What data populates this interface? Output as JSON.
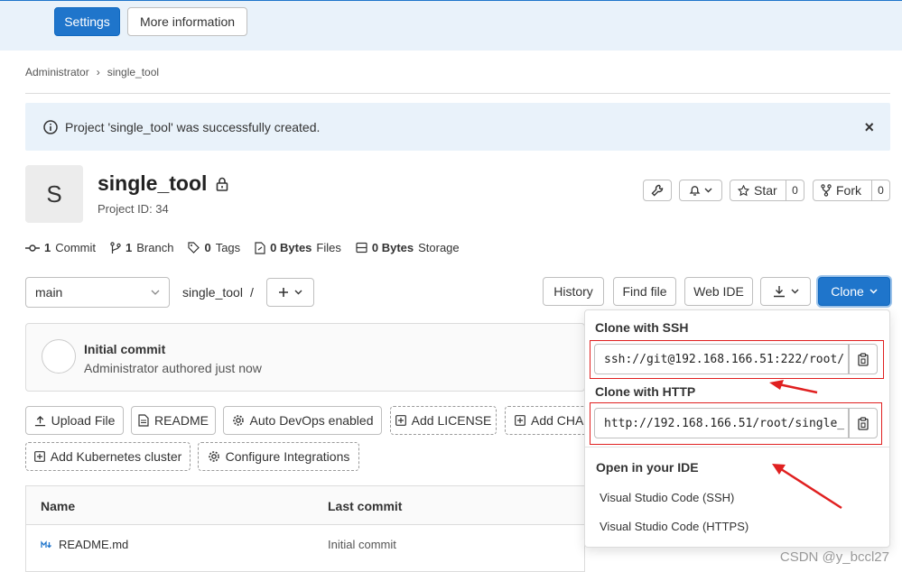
{
  "top": {
    "settings": "Settings",
    "more_info": "More information"
  },
  "breadcrumb": {
    "parent": "Administrator",
    "sep": "›",
    "current": "single_tool"
  },
  "alert": {
    "text": "Project 'single_tool' was successfully created.",
    "close": "×"
  },
  "project": {
    "avatar_letter": "S",
    "name": "single_tool",
    "id_text": "Project ID: 34"
  },
  "actions": {
    "star": "Star",
    "star_count": "0",
    "fork": "Fork",
    "fork_count": "0"
  },
  "stats": {
    "commits_n": "1",
    "commits_label": "Commit",
    "branches_n": "1",
    "branches_label": "Branch",
    "tags_n": "0",
    "tags_label": "Tags",
    "files_n": "0 Bytes",
    "files_label": "Files",
    "storage_n": "0 Bytes",
    "storage_label": "Storage"
  },
  "repo": {
    "branch": "main",
    "path": "single_tool",
    "path_sep": "/",
    "history": "History",
    "find_file": "Find file",
    "web_ide": "Web IDE",
    "clone": "Clone"
  },
  "commit": {
    "title": "Initial commit",
    "author": "Administrator",
    "meta": "authored just now"
  },
  "quick": {
    "upload": "Upload File",
    "readme": "README",
    "autodevops": "Auto DevOps enabled",
    "license": "Add LICENSE",
    "changelog": "Add CHA",
    "k8s": "Add Kubernetes cluster",
    "integrations": "Configure Integrations"
  },
  "table": {
    "headers": [
      "Name",
      "Last commit"
    ],
    "rows": [
      {
        "name": "README.md",
        "last_commit": "Initial commit"
      }
    ]
  },
  "clone_dropdown": {
    "ssh_label": "Clone with SSH",
    "ssh_url": "ssh://git@192.168.166.51:222/root/",
    "http_label": "Clone with HTTP",
    "http_url": "http://192.168.166.51/root/single_",
    "ide_label": "Open in your IDE",
    "ide_ssh": "Visual Studio Code (SSH)",
    "ide_https": "Visual Studio Code (HTTPS)"
  },
  "watermark": "CSDN @y_bccl27",
  "colors": {
    "primary": "#1f75cb",
    "annotation": "#e02020",
    "alert_bg": "#e9f2fa"
  }
}
